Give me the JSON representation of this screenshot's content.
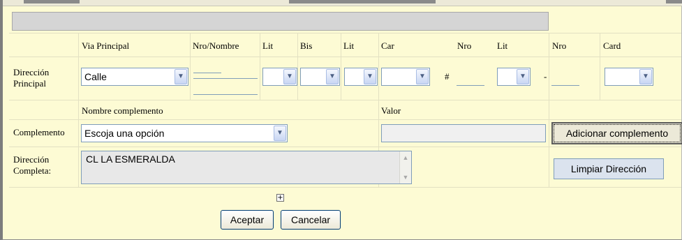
{
  "columns": {
    "via_principal": "Via Principal",
    "nro_nombre": "Nro/Nombre",
    "lit1": "Lit",
    "bis": "Bis",
    "lit2": "Lit",
    "car": "Car",
    "nro2": "Nro",
    "lit3": "Lit",
    "nro3": "Nro",
    "card": "Card"
  },
  "direccion_principal": {
    "label": "Dirección Principal",
    "via_value": "Calle",
    "hash": "#",
    "dash": "-"
  },
  "complemento": {
    "header_nombre": "Nombre complemento",
    "header_valor": "Valor",
    "label": "Complemento",
    "select_value": "Escoja una opción",
    "add_button": "Adicionar complemento"
  },
  "direccion_completa": {
    "label": "Dirección Completa:",
    "value": "CL   LA ESMERALDA",
    "clear_button": "Limpiar Dirección"
  },
  "expand": "+",
  "actions": {
    "accept": "Aceptar",
    "cancel": "Cancelar"
  }
}
